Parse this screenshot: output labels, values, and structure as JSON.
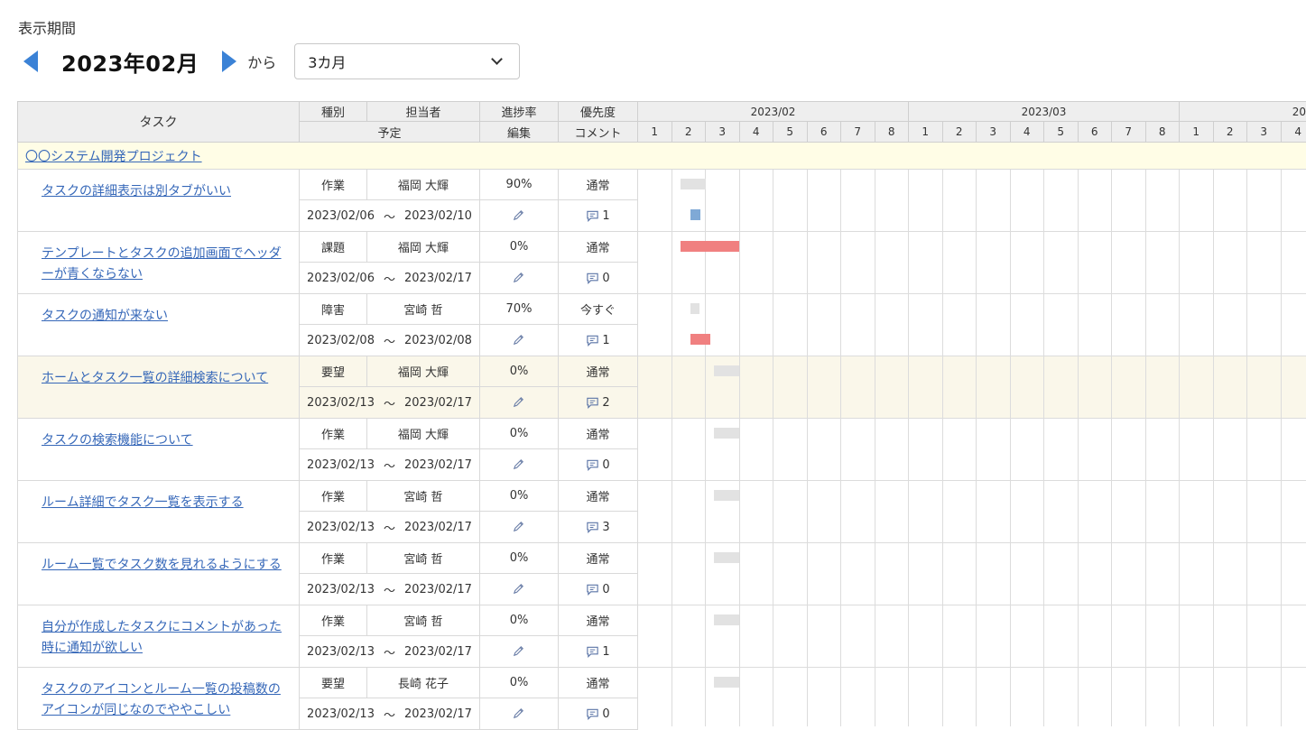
{
  "header": {
    "period_label": "表示期間",
    "month": "2023年02月",
    "from_label": "から",
    "range_value": "3カ月"
  },
  "columns": {
    "task": "タスク",
    "type": "種別",
    "assignee": "担当者",
    "progress": "進捗率",
    "priority": "優先度",
    "schedule": "予定",
    "edit": "編集",
    "comment": "コメント"
  },
  "months": [
    "2023/02",
    "2023/03",
    "20"
  ],
  "weeks": [
    "1",
    "2",
    "3",
    "4",
    "5",
    "6",
    "7",
    "8",
    "1",
    "2",
    "3",
    "4",
    "5",
    "6",
    "7",
    "8",
    "1",
    "2",
    "3",
    "4"
  ],
  "project": {
    "name": "〇〇システム開発プロジェクト"
  },
  "tasks": [
    {
      "title": "タスクの詳細表示は別タブがいい",
      "type": "作業",
      "assignee": "福岡 大輝",
      "progress": "90%",
      "priority": "通常",
      "start": "2023/02/06",
      "tilde": "〜",
      "end": "2023/02/10",
      "comments": "1"
    },
    {
      "title": "テンプレートとタスクの追加画面でヘッダーが青くならない",
      "type": "課題",
      "assignee": "福岡 大輝",
      "progress": "0%",
      "priority": "通常",
      "start": "2023/02/06",
      "tilde": "〜",
      "end": "2023/02/17",
      "comments": "0"
    },
    {
      "title": "タスクの通知が来ない",
      "type": "障害",
      "assignee": "宮崎 哲",
      "progress": "70%",
      "priority": "今すぐ",
      "start": "2023/02/08",
      "tilde": "〜",
      "end": "2023/02/08",
      "comments": "1"
    },
    {
      "title": "ホームとタスク一覧の詳細検索について",
      "type": "要望",
      "assignee": "福岡 大輝",
      "progress": "0%",
      "priority": "通常",
      "start": "2023/02/13",
      "tilde": "〜",
      "end": "2023/02/17",
      "comments": "2"
    },
    {
      "title": "タスクの検索機能について",
      "type": "作業",
      "assignee": "福岡 大輝",
      "progress": "0%",
      "priority": "通常",
      "start": "2023/02/13",
      "tilde": "〜",
      "end": "2023/02/17",
      "comments": "0"
    },
    {
      "title": "ルーム詳細でタスク一覧を表示する",
      "type": "作業",
      "assignee": "宮崎 哲",
      "progress": "0%",
      "priority": "通常",
      "start": "2023/02/13",
      "tilde": "〜",
      "end": "2023/02/17",
      "comments": "3"
    },
    {
      "title": "ルーム一覧でタスク数を見れるようにする",
      "type": "作業",
      "assignee": "宮崎 哲",
      "progress": "0%",
      "priority": "通常",
      "start": "2023/02/13",
      "tilde": "〜",
      "end": "2023/02/17",
      "comments": "0"
    },
    {
      "title": "自分が作成したタスクにコメントがあった時に通知が欲しい",
      "type": "作業",
      "assignee": "宮崎 哲",
      "progress": "0%",
      "priority": "通常",
      "start": "2023/02/13",
      "tilde": "〜",
      "end": "2023/02/17",
      "comments": "1"
    },
    {
      "title": "タスクのアイコンとルーム一覧の投稿数のアイコンが同じなのでややこしい",
      "type": "要望",
      "assignee": "長崎 花子",
      "progress": "0%",
      "priority": "通常",
      "start": "2023/02/13",
      "tilde": "〜",
      "end": "2023/02/17",
      "comments": "0"
    }
  ],
  "colors": {
    "accent": "#3b82d6",
    "link": "#3567b8",
    "project_row": "#fffde6",
    "highlight_row": "#faf7ea",
    "plan_bar": "#e2e2e2",
    "progress_blue": "#7fa9d6",
    "progress_red": "#f08080"
  },
  "icons": {
    "prev": "triangle-left-icon",
    "next": "triangle-right-icon",
    "dropdown": "chevron-down-icon",
    "edit": "pencil-icon",
    "comment": "comment-icon"
  }
}
